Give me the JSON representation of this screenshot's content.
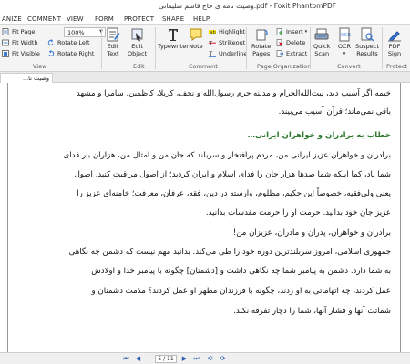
{
  "window": {
    "title": "وصیت نامه ی حاج قاسم سلیمانی.pdf - Foxit PhantomPDF"
  },
  "menu": [
    "ANIZE",
    "COMMENT",
    "VIEW",
    "FORM",
    "PROTECT",
    "SHARE",
    "HELP"
  ],
  "ribbon": {
    "view_group": {
      "label": "View",
      "fit_page": "Fit Page",
      "fit_width": "Fit Width",
      "fit_visible": "Fit Visible",
      "zoom_value": "100%",
      "rotate_left": "Rotate Left",
      "rotate_right": "Rotate Right"
    },
    "edit_group": {
      "label": "Edit",
      "edit_text": [
        "Edit",
        "Text"
      ],
      "edit_object": [
        "Edit",
        "Object"
      ]
    },
    "comment_group": {
      "label": "Comment",
      "typewriter": "Typewriter",
      "note": "Note",
      "highlight": "Highlight",
      "strikeout": "Strikeout",
      "underline": "Underline"
    },
    "page_org_group": {
      "label": "Page Organization",
      "rotate_pages": [
        "Rotate",
        "Pages"
      ],
      "insert": "Insert",
      "delete": "Delete",
      "extract": "Extract"
    },
    "convert_group": {
      "label": "Convert",
      "quick_scan": [
        "Quick",
        "Scan"
      ],
      "ocr": "OCR",
      "suspect_results": [
        "Suspect",
        "Results"
      ]
    },
    "protect_group": {
      "label": "Protect",
      "pdf_sign": [
        "PDF",
        "Sign"
      ]
    }
  },
  "tab": {
    "name": "وصیت نا..."
  },
  "document": {
    "lines": [
      {
        "text": "خیمه اگر آسیب دید، بیت‌الله‌الحرام و مدینه حرم رسول‌الله و نجف، کربلا، کاظمین، سامرا و مشهد",
        "heading": false
      },
      {
        "text": "باقی نمی‌ماند؛ قرآن آسیب می‌بیند.",
        "heading": false
      },
      {
        "text": "خطاب به برادران و خواهران ایرانی…",
        "heading": true
      },
      {
        "text": "برادران و خواهران عزیز ایرانی من، مردم پرافتخار و سربلند که جان من و امثال من، هزاران بار فدای",
        "heading": false
      },
      {
        "text": "شما باد، کما اینکه شما صدها هزار جان را فدای اسلام و ایران کردید؛ از اصول مراقبت کنید. اصول",
        "heading": false
      },
      {
        "text": "یعنی ولی‌فقیه، خصوصاً این حکیم، مظلوم، وارسته در دین، فقه، عرفان، معرفت؛ خامنه‌ای عزیز را",
        "heading": false
      },
      {
        "text": "عزیز جان خود بدانید. حرمت او را حرمت مقدسات بدانید.",
        "heading": false
      },
      {
        "text": "برادران و خواهران، پدران و مادران، عزیزان من!",
        "heading": false
      },
      {
        "text": "جمهوری اسلامی، امروز سربلندترین دوره خود را طی می‌کند. بدانید مهم نیست که دشمن چه نگاهی",
        "heading": false
      },
      {
        "text": "به شما دارد. دشمن به پیامبر شما چه نگاهی داشت و [دشمنان] چگونه با پیامبر خدا و اولادش",
        "heading": false
      },
      {
        "text": "عمل کردند، چه اتهاماتی به او زدند، چگونه با فرزندان مطهر او عمل کردند؟ مذمت دشمنان و",
        "heading": false
      },
      {
        "text": "شماتت آنها و فشار آنها، شما را دچار تفرقه نکند.",
        "heading": false
      }
    ]
  },
  "navigation": {
    "page_display": "5 / 11"
  }
}
